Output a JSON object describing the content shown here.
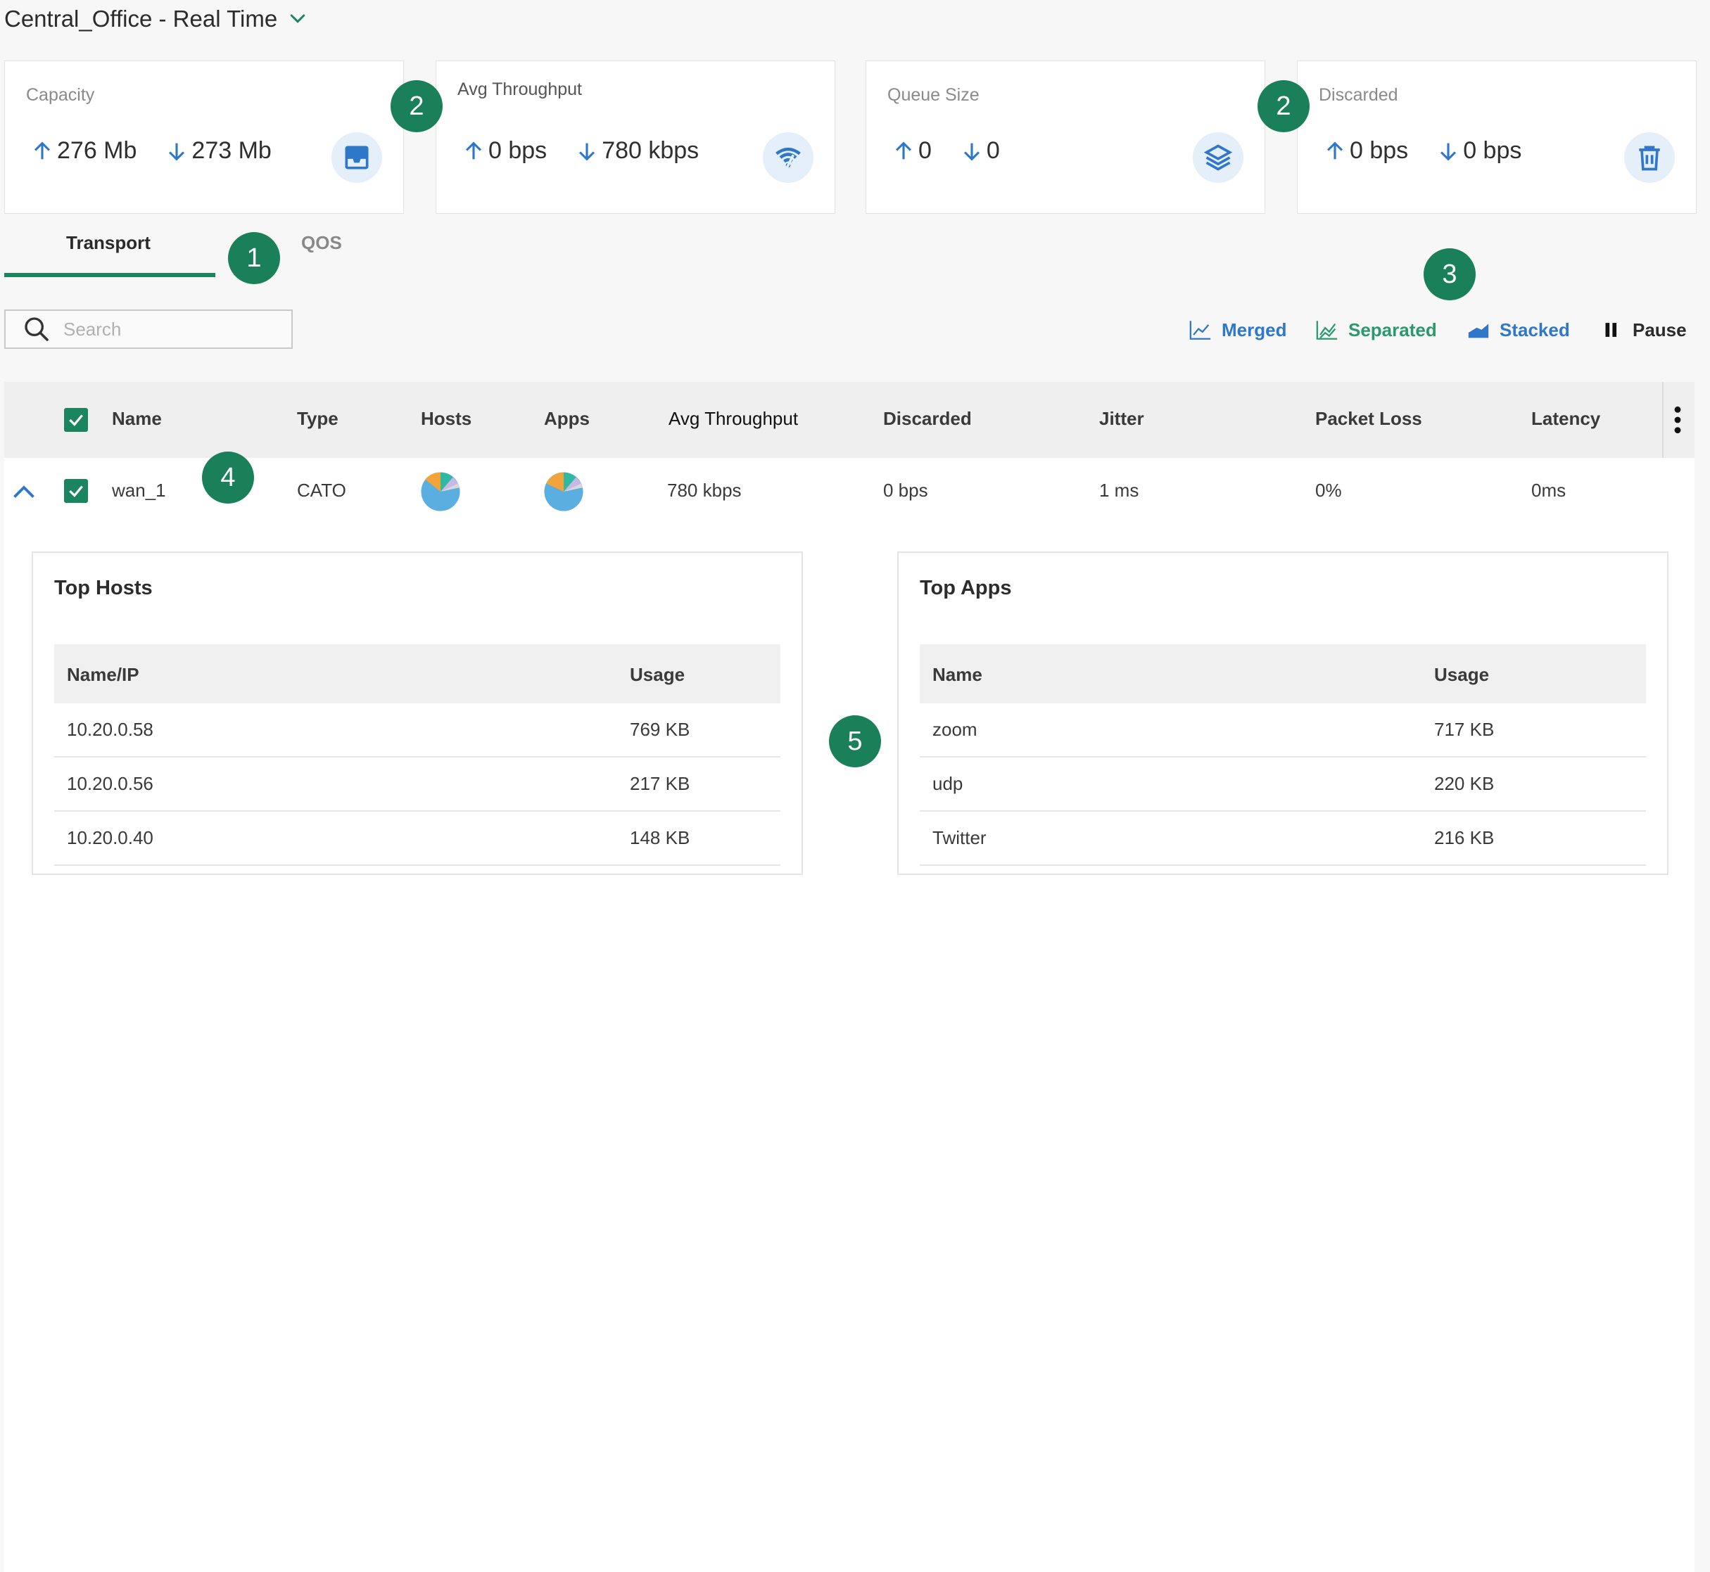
{
  "header": {
    "title": "Central_Office - Real Time"
  },
  "cards": [
    {
      "label": "Capacity",
      "up": "276 Mb",
      "down": "273 Mb",
      "icon": "inbox-icon"
    },
    {
      "label": "Avg Throughput",
      "up": "0 bps",
      "down": "780 kbps",
      "icon": "wifi-icon"
    },
    {
      "label": "Queue Size",
      "up": "0",
      "down": "0",
      "icon": "layers-icon"
    },
    {
      "label": "Discarded",
      "up": "0 bps",
      "down": "0 bps",
      "icon": "trash-icon"
    }
  ],
  "tabs": [
    {
      "label": "Transport",
      "active": true
    },
    {
      "label": "QOS",
      "active": false
    }
  ],
  "search": {
    "placeholder": "Search"
  },
  "view_buttons": [
    {
      "label": "Merged",
      "color": "#2f77c8"
    },
    {
      "label": "Separated",
      "color": "#2a9a6c"
    },
    {
      "label": "Stacked",
      "color": "#2f77c8"
    },
    {
      "label": "Pause",
      "color": "#2b2b2b"
    }
  ],
  "callouts": [
    "1",
    "2",
    "2",
    "3",
    "4",
    "5"
  ],
  "table": {
    "columns": [
      "Name",
      "Type",
      "Hosts",
      "Apps",
      "Avg Throughput",
      "Discarded",
      "Jitter",
      "Packet Loss",
      "Latency"
    ],
    "rows": [
      {
        "name": "wan_1",
        "type": "CATO",
        "avg_throughput": "780 kbps",
        "discarded": "0 bps",
        "jitter": "1 ms",
        "packet_loss": "0%",
        "latency": "0ms"
      }
    ]
  },
  "top_hosts": {
    "title": "Top Hosts",
    "columns": [
      "Name/IP",
      "Usage"
    ],
    "rows": [
      {
        "name": "10.20.0.58",
        "usage": "769 KB"
      },
      {
        "name": "10.20.0.56",
        "usage": "217 KB"
      },
      {
        "name": "10.20.0.40",
        "usage": "148 KB"
      }
    ]
  },
  "top_apps": {
    "title": "Top Apps",
    "columns": [
      "Name",
      "Usage"
    ],
    "rows": [
      {
        "name": "zoom",
        "usage": "717 KB"
      },
      {
        "name": "udp",
        "usage": "220 KB"
      },
      {
        "name": "Twitter",
        "usage": "216 KB"
      }
    ]
  },
  "colors": {
    "accent_green": "#1b8560",
    "accent_blue": "#2f77c8",
    "icon_bg": "#e4effa"
  }
}
